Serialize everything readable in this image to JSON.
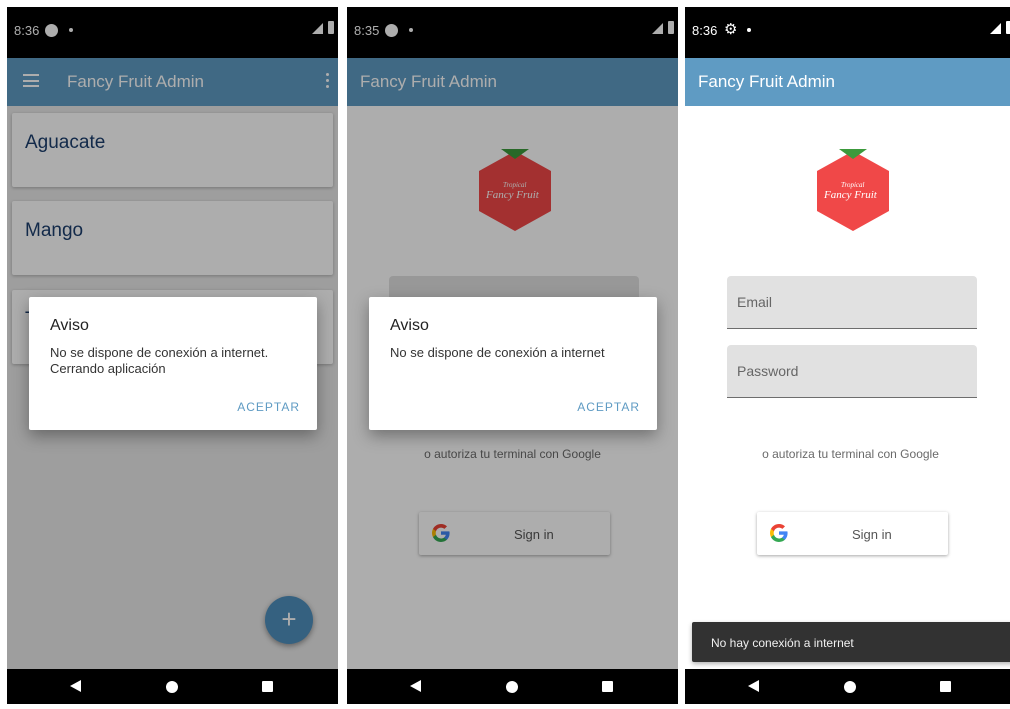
{
  "colors": {
    "appbar": "#5f9bc3",
    "accent": "#5f9bc3",
    "fab": "#4f8fbd",
    "fruit_text": "#1c3f6e",
    "logo_red": "#f04848",
    "logo_green": "#3c9a3c"
  },
  "screens": [
    {
      "status": {
        "time": "8:36",
        "icons": [
          "notification-dot-icon",
          "signal-icon",
          "battery-icon"
        ]
      },
      "app_title": "Fancy Fruit Admin",
      "fruits": [
        "Aguacate",
        "Mango",
        "T"
      ],
      "fab_label": "+",
      "dialog": {
        "title": "Aviso",
        "message": "No se dispone de conexión a internet. Cerrando aplicación",
        "button": "ACEPTAR"
      }
    },
    {
      "status": {
        "time": "8:35",
        "icons": [
          "notification-dot-icon",
          "signal-icon",
          "battery-icon"
        ]
      },
      "app_title": "Fancy Fruit Admin",
      "logo": {
        "line1": "Tropical",
        "line2": "Fancy Fruit"
      },
      "google_hint": "o autoriza tu terminal con Google",
      "signin_label": "Sign in",
      "dialog": {
        "title": "Aviso",
        "message": "No se dispone de conexión a internet",
        "button": "ACEPTAR"
      }
    },
    {
      "status": {
        "time": "8:36",
        "icons": [
          "gear-icon",
          "signal-icon",
          "battery-icon"
        ]
      },
      "app_title": "Fancy Fruit Admin",
      "logo": {
        "line1": "Tropical",
        "line2": "Fancy Fruit"
      },
      "email_placeholder": "Email",
      "password_placeholder": "Password",
      "google_hint": "o autoriza tu terminal con Google",
      "signin_label": "Sign in",
      "snackbar": "No hay conexión a internet"
    }
  ]
}
